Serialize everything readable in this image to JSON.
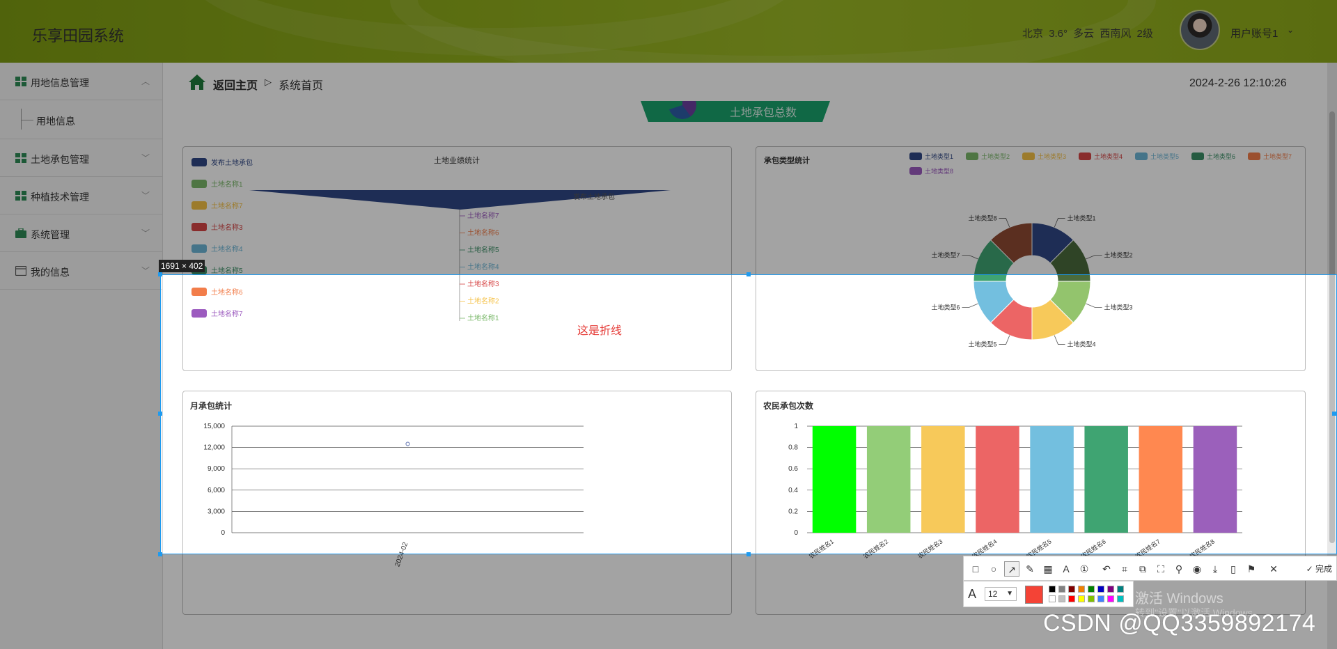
{
  "header": {
    "title": "乐享田园系统",
    "weather": "北京  3.6°  多云  西南风  2级",
    "user": "用户账号1"
  },
  "sidebar": {
    "items": [
      {
        "label": "用地信息管理",
        "icon": "grid-icon"
      },
      {
        "label": "用地信息",
        "sub": true
      },
      {
        "label": "土地承包管理",
        "icon": "grid-icon"
      },
      {
        "label": "种植技术管理",
        "icon": "grid-icon"
      },
      {
        "label": "系统管理",
        "icon": "briefcase-icon"
      },
      {
        "label": "我的信息",
        "icon": "card-icon"
      }
    ]
  },
  "breadcrumb": {
    "home": "返回主页",
    "separator": "▷",
    "current": "系统首页"
  },
  "datetime": "2024-2-26 12:10:26",
  "total_badge": "土地承包总数",
  "cards": {
    "funnel": {
      "title": "土地业绩统计",
      "legend": [
        "发布土地承包",
        "土地名称1",
        "土地名称7",
        "土地名称3",
        "土地名称4",
        "土地名称5",
        "土地名称6",
        "土地名称7"
      ],
      "top_label": "发布土地承包",
      "labels": [
        "土地名称7",
        "土地名称6",
        "土地名称5",
        "土地名称4",
        "土地名称3",
        "土地名称2",
        "土地名称1"
      ]
    },
    "pie": {
      "title": "承包类型统计",
      "legend": [
        "土地类型1",
        "土地类型2",
        "土地类型3",
        "土地类型4",
        "土地类型5",
        "土地类型6",
        "土地类型7",
        "土地类型8"
      ],
      "slice_labels": [
        "土地类型1",
        "土地类型2",
        "土地类型3",
        "土地类型4",
        "土地类型5",
        "土地类型6",
        "土地类型7",
        "土地类型8"
      ]
    },
    "line": {
      "title": "月承包统计",
      "y_ticks": [
        "15,000",
        "12,000",
        "9,000",
        "6,000",
        "3,000",
        "0"
      ],
      "x_label": "2024-02"
    },
    "bar": {
      "title": "农民承包次数",
      "y_ticks": [
        "1",
        "0.8",
        "0.6",
        "0.4",
        "0.2",
        "0"
      ],
      "x_labels": [
        "农民姓名1",
        "农民姓名2",
        "农民姓名3",
        "农民姓名4",
        "农民姓名5",
        "农民姓名6",
        "农民姓名7",
        "农民姓名8"
      ]
    }
  },
  "colors": {
    "accent": "#1aa36c",
    "header": "#8fac1c",
    "pie": [
      "#2f4785",
      "#4a6b3c",
      "#93c46d",
      "#f7c95a",
      "#ec6565",
      "#73bfdf",
      "#3fa472",
      "#8f4a33",
      "#6a3f86"
    ],
    "legend": [
      "#2f4785",
      "#7ab86a",
      "#f5c146",
      "#d64545",
      "#6db6d6",
      "#3a8f66",
      "#f27d4a",
      "#9c5bbf"
    ],
    "bars": [
      "#00ff00",
      "#93cd78",
      "#f7c95a",
      "#ec6565",
      "#73bfdf",
      "#3fa472",
      "#ff8850",
      "#9b60bb"
    ]
  },
  "chart_data": [
    {
      "type": "bar",
      "title": "农民承包次数",
      "categories": [
        "农民姓名1",
        "农民姓名2",
        "农民姓名3",
        "农民姓名4",
        "农民姓名5",
        "农民姓名6",
        "农民姓名7",
        "农民姓名8"
      ],
      "values": [
        1,
        1,
        1,
        1,
        1,
        1,
        1,
        1
      ],
      "ylim": [
        0,
        1
      ]
    },
    {
      "type": "line",
      "title": "月承包统计",
      "x": [
        "2024-02"
      ],
      "values": [
        12500
      ],
      "ylim": [
        0,
        15000
      ]
    },
    {
      "type": "pie",
      "title": "承包类型统计",
      "categories": [
        "土地类型1",
        "土地类型2",
        "土地类型3",
        "土地类型4",
        "土地类型5",
        "土地类型6",
        "土地类型7",
        "土地类型8"
      ],
      "values": [
        1,
        1,
        1,
        1,
        1,
        1,
        1,
        1
      ]
    }
  ],
  "capture": {
    "size_tip": "1691 × 402",
    "annotation": "这是折线",
    "font_size": "12",
    "done_label": "完成",
    "win_activate": "激活 Windows",
    "win_activate_sub": "转到\"设置\"以激活 Windows。",
    "watermark": "CSDN @QQ3359892174"
  }
}
